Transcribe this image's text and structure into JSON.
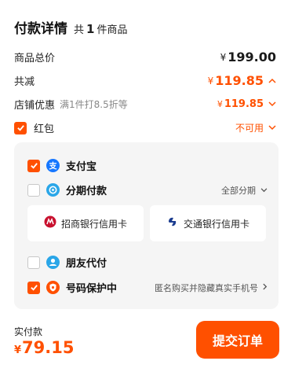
{
  "header": {
    "title": "付款详情",
    "count_prefix": "共",
    "count": "1",
    "count_suffix": "件商品"
  },
  "summary": {
    "total_label": "商品总价",
    "total_currency": "¥",
    "total_value": "199.00",
    "discount_label": "共减",
    "discount_currency": "¥",
    "discount_value": "119.85",
    "store_label": "店铺优惠",
    "store_sub": "满1件打8.5折等",
    "store_currency": "¥",
    "store_value": "119.85",
    "redpack_label": "红包",
    "redpack_status": "不可用"
  },
  "payment": {
    "methods": [
      {
        "name": "支付宝",
        "checked": true,
        "icon": "alipay-icon"
      },
      {
        "name": "分期付款",
        "checked": false,
        "icon": "installment-icon",
        "right": "全部分期"
      },
      {
        "name": "朋友代付",
        "checked": false,
        "icon": "friend-pay-icon"
      },
      {
        "name": "号码保护中",
        "checked": true,
        "icon": "phone-shield-icon",
        "right": "匿名购买并隐藏真实手机号"
      }
    ],
    "cards": [
      {
        "name": "招商银行信用卡",
        "icon": "cmb-bank-icon"
      },
      {
        "name": "交通银行信用卡",
        "icon": "bocom-bank-icon"
      }
    ]
  },
  "footer": {
    "label": "实付款",
    "currency": "¥",
    "amount": "79.15",
    "submit_label": "提交订单"
  },
  "colors": {
    "accent": "#ff5000",
    "alipay": "#1677ff",
    "installment": "#2aa6e8"
  }
}
